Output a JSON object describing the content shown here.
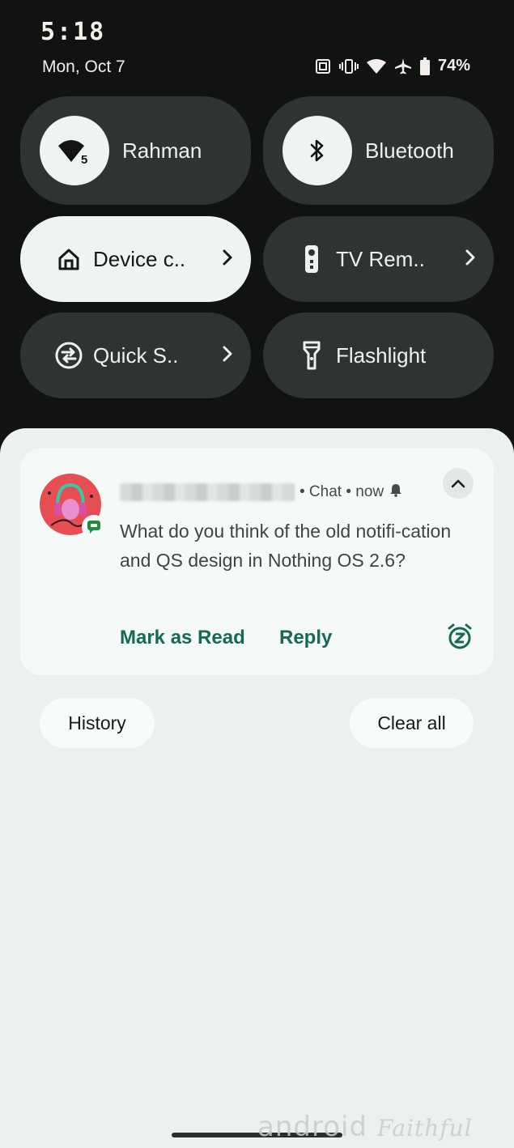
{
  "status_bar": {
    "clock": "5:18",
    "date": "Mon, Oct 7",
    "battery": "74%",
    "icons": [
      "nfc-icon",
      "vibrate-icon",
      "wifi-icon",
      "airplane-icon",
      "battery-icon"
    ]
  },
  "quick_settings": {
    "wifi": {
      "label": "Rahman",
      "badge": "5"
    },
    "bluetooth": {
      "label": "Bluetooth"
    },
    "device_controls": {
      "label": "Device c.."
    },
    "tv_remote": {
      "label": "TV Rem.."
    },
    "quick_share": {
      "label": "Quick S.."
    },
    "flashlight": {
      "label": "Flashlight"
    }
  },
  "notification": {
    "app": "• Chat • now",
    "message": "What do you think of the old notifi-cation and QS design in Nothing OS 2.6?",
    "actions": {
      "mark_read": "Mark as Read",
      "reply": "Reply"
    }
  },
  "shade_buttons": {
    "history": "History",
    "clear_all": "Clear all"
  },
  "watermark": {
    "main": "android",
    "script": "Faithful"
  },
  "colors": {
    "accent": "#146a56",
    "avatar": "#e64e52",
    "badge": "#1e8e3e"
  }
}
